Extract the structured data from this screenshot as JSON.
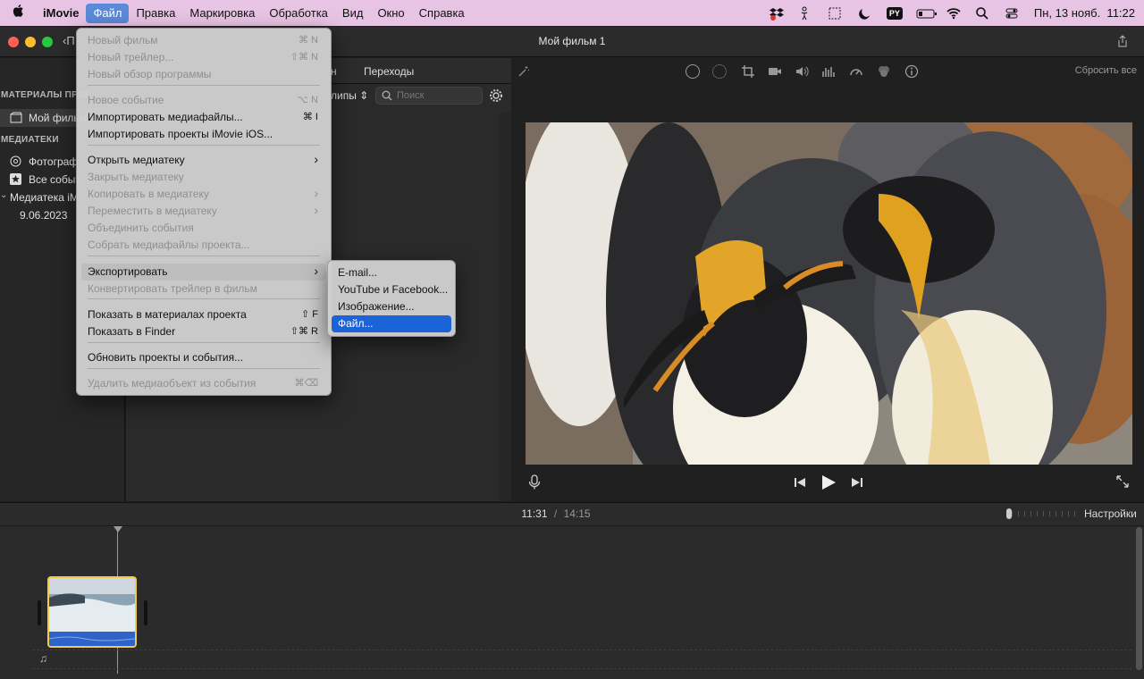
{
  "menubar": {
    "apple": "",
    "items": [
      "iMovie",
      "Файл",
      "Правка",
      "Маркировка",
      "Обработка",
      "Вид",
      "Окно",
      "Справка"
    ],
    "input_source": "PY",
    "datetime": "Пн, 13 нояб.  11:22"
  },
  "window": {
    "title": "Мой фильм 1",
    "back_label": "П"
  },
  "browser": {
    "tabs_partial": "н",
    "tab_transitions": "Переходы",
    "clips_filter": "липы",
    "search_placeholder": "Поиск"
  },
  "viewer": {
    "reset_all": "Сбросить все"
  },
  "sidebar": {
    "projects_header": "МАТЕРИАЛЫ ПРОЕ",
    "project_item": "Мой фильм",
    "libraries_header": "МЕДИАТЕКИ",
    "photos_item": "Фотограф",
    "all_events_item": "Все событ",
    "library_item": "Медиатека iM",
    "event_date": "9.06.2023"
  },
  "timeline": {
    "current_time": "11:31",
    "separator": "/",
    "total_time": "14:15",
    "settings_label": "Настройки"
  },
  "file_menu": {
    "items": [
      {
        "label": "Новый фильм",
        "shortcut": "⌘ N",
        "enabled": false
      },
      {
        "label": "Новый трейлер...",
        "shortcut": "⇧⌘ N",
        "enabled": false
      },
      {
        "label": "Новый обзор программы",
        "shortcut": "",
        "enabled": false
      },
      {
        "label": "Новое событие",
        "shortcut": "⌥ N",
        "enabled": false
      },
      {
        "label": "Импортировать медиафайлы...",
        "shortcut": "⌘ I",
        "enabled": true
      },
      {
        "label": "Импортировать проекты iMovie iOS...",
        "shortcut": "",
        "enabled": true
      },
      {
        "label": "Открыть медиатеку",
        "shortcut": "›",
        "enabled": true
      },
      {
        "label": "Закрыть медиатеку",
        "shortcut": "",
        "enabled": false
      },
      {
        "label": "Копировать в медиатеку",
        "shortcut": "›",
        "enabled": false
      },
      {
        "label": "Переместить в медиатеку",
        "shortcut": "›",
        "enabled": false
      },
      {
        "label": "Объединить события",
        "shortcut": "",
        "enabled": false
      },
      {
        "label": "Собрать медиафайлы проекта...",
        "shortcut": "",
        "enabled": false
      },
      {
        "label": "Экспортировать",
        "shortcut": "›",
        "enabled": true
      },
      {
        "label": "Конвертировать трейлер в фильм",
        "shortcut": "",
        "enabled": false
      },
      {
        "label": "Показать в материалах проекта",
        "shortcut": "⇧ F",
        "enabled": true
      },
      {
        "label": "Показать в Finder",
        "shortcut": "⇧⌘ R",
        "enabled": true
      },
      {
        "label": "Обновить проекты и события...",
        "shortcut": "",
        "enabled": true
      },
      {
        "label": "Удалить медиаобъект из события",
        "shortcut": "⌘⌫",
        "enabled": false
      }
    ]
  },
  "export_submenu": {
    "items": [
      "E-mail...",
      "YouTube и Facebook...",
      "Изображение...",
      "Файл..."
    ],
    "selected": "Файл..."
  },
  "colors": {
    "menubar_bg": "#e8c4e4",
    "selection": "#1a63d8",
    "clip_border": "#f2c94c",
    "playhead": "#9a9a9a"
  }
}
